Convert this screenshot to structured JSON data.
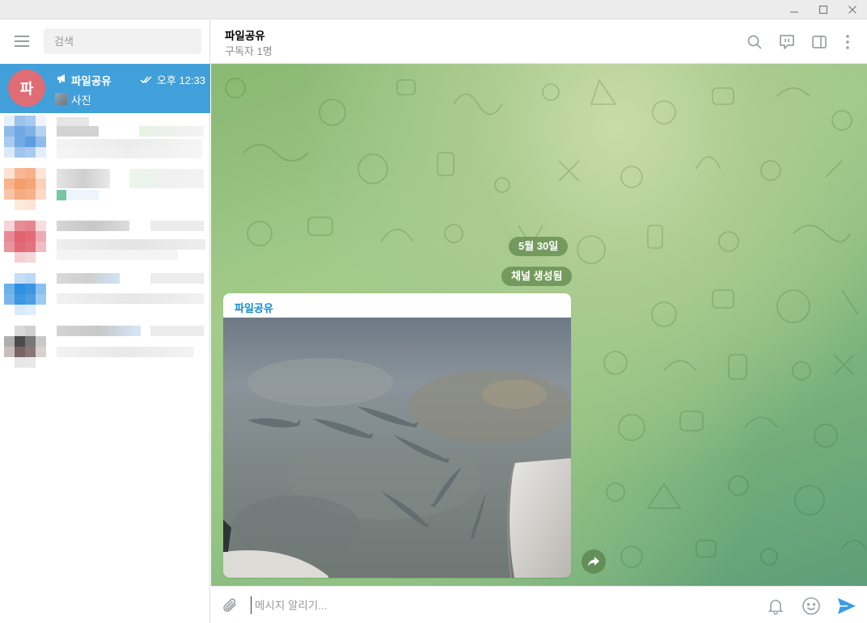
{
  "window": {
    "minimize_icon": "minimize-icon",
    "maximize_icon": "maximize-icon",
    "close_icon": "close-icon"
  },
  "sidebar": {
    "search_placeholder": "검색",
    "active_chat": {
      "avatar_letter": "파",
      "avatar_color": "#e06c75",
      "name": "파일공유",
      "time": "오후 12:33",
      "preview": "사진",
      "read_status_icon": "double-check-icon",
      "channel_icon": "megaphone-icon"
    }
  },
  "header": {
    "title": "파일공유",
    "subtitle": "구독자 1명",
    "icons": [
      "search-icon",
      "live-stream-icon",
      "sidebar-toggle-icon",
      "more-icon"
    ]
  },
  "chat": {
    "date_label": "5월 30일",
    "service_message": "채널 생성됨",
    "message": {
      "author": "파일공유",
      "type": "photo"
    }
  },
  "composer": {
    "placeholder": "메시지 알리기...",
    "icons": [
      "attach-icon",
      "bell-icon",
      "emoji-icon",
      "send-icon"
    ]
  },
  "colors": {
    "accent": "#419fd9",
    "author_color": "#168acd",
    "send_color": "#3a9ee4"
  }
}
